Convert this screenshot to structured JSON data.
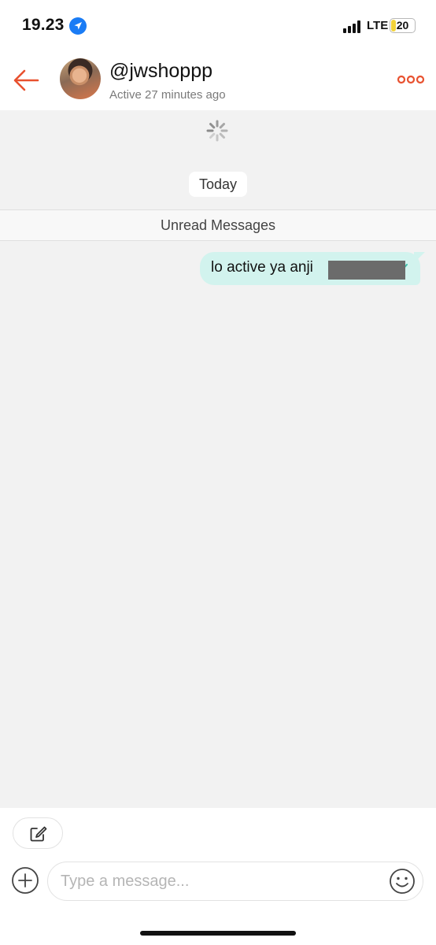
{
  "status_bar": {
    "time": "19.23",
    "network": "LTE",
    "battery_level": "20",
    "battery_fraction": 0.2,
    "location_icon": "location-arrow-icon",
    "signal_icon": "cellular-signal-icon"
  },
  "header": {
    "back_icon": "back-arrow-icon",
    "username": "@jwshoppp",
    "status": "Active 27 minutes ago",
    "more_icon": "more-options-icon",
    "accent_color": "#e8512f"
  },
  "conversation": {
    "loading_icon": "loading-spinner-icon",
    "date_label": "Today",
    "unread_label": "Unread Messages",
    "messages": [
      {
        "text": "lo active ya anji",
        "direction": "outgoing",
        "redacted": true,
        "bubble_color": "#d2f3ee"
      }
    ]
  },
  "composer": {
    "tool_icon": "edit-note-icon",
    "add_icon": "plus-circle-icon",
    "placeholder": "Type a message...",
    "emoji_icon": "emoji-smiley-icon"
  }
}
